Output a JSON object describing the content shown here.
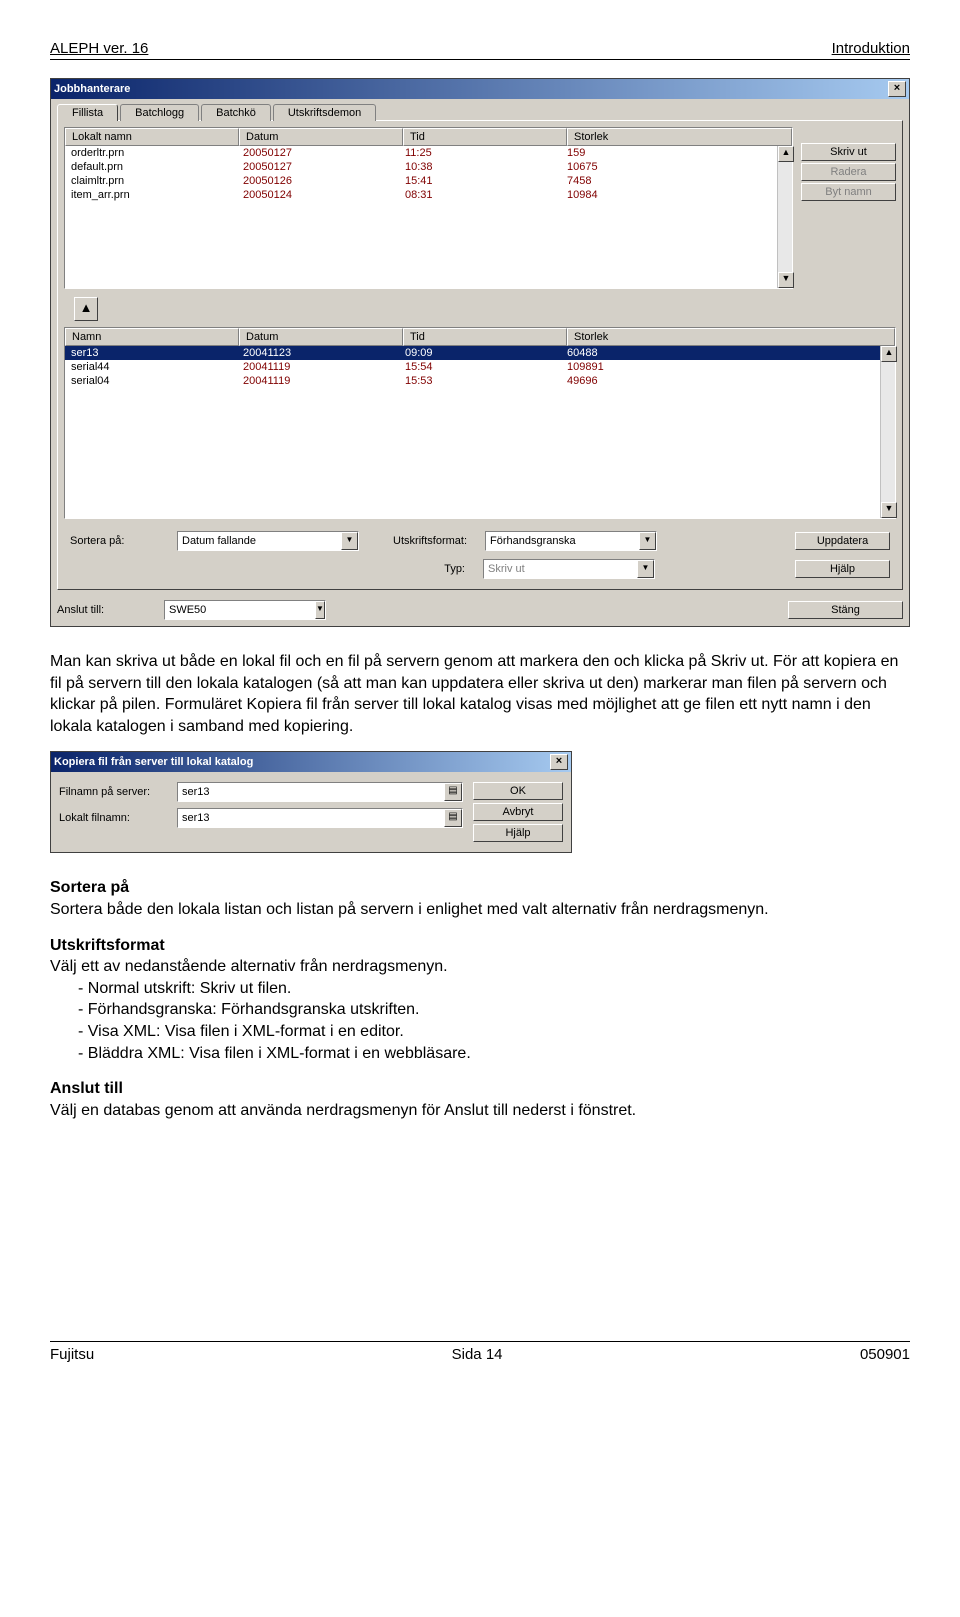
{
  "header": {
    "left": "ALEPH ver. 16",
    "right": "Introduktion"
  },
  "window1": {
    "title": "Jobbhanterare",
    "tabs": [
      "Fillista",
      "Batchlogg",
      "Batchkö",
      "Utskriftsdemon"
    ],
    "cols_top": [
      "Lokalt namn",
      "Datum",
      "Tid",
      "Storlek"
    ],
    "rows_top": [
      {
        "name": "orderltr.prn",
        "date": "20050127",
        "time": "11:25",
        "size": "159"
      },
      {
        "name": "default.prn",
        "date": "20050127",
        "time": "10:38",
        "size": "10675"
      },
      {
        "name": "claimltr.prn",
        "date": "20050126",
        "time": "15:41",
        "size": "7458"
      },
      {
        "name": "item_arr.prn",
        "date": "20050124",
        "time": "08:31",
        "size": "10984"
      }
    ],
    "rbtns": {
      "print": "Skriv ut",
      "delete": "Radera",
      "rename": "Byt namn"
    },
    "arrow": "▲",
    "cols_bot": [
      "Namn",
      "Datum",
      "Tid",
      "Storlek"
    ],
    "rows_bot": [
      {
        "name": "ser13",
        "date": "20041123",
        "time": "09:09",
        "size": "60488"
      },
      {
        "name": "serial44",
        "date": "20041119",
        "time": "15:54",
        "size": "109891"
      },
      {
        "name": "serial04",
        "date": "20041119",
        "time": "15:53",
        "size": "49696"
      }
    ],
    "sort_label": "Sortera på:",
    "sort_value": "Datum fallande",
    "format_label": "Utskriftsformat:",
    "format_value": "Förhandsgranska",
    "type_label": "Typ:",
    "type_value": "Skriv ut",
    "update_btn": "Uppdatera",
    "help_btn": "Hjälp",
    "connect_label": "Anslut till:",
    "connect_value": "SWE50",
    "close_btn": "Stäng"
  },
  "text1": "Man kan skriva ut både en lokal fil och en fil på servern genom att markera den och klicka på Skriv ut. För att kopiera en fil på servern till den lokala katalogen (så att man kan uppdatera eller skriva ut den) markerar man filen på servern och klickar på pilen. Formuläret Kopiera fil från server till lokal katalog visas med möjlighet att ge filen ett nytt namn i den lokala katalogen i samband med kopiering.",
  "dialog2": {
    "title": "Kopiera fil från server till lokal katalog",
    "fn_server_label": "Filnamn på server:",
    "fn_server_value": "ser13",
    "fn_local_label": "Lokalt filnamn:",
    "fn_local_value": "ser13",
    "ok": "OK",
    "cancel": "Avbryt",
    "help": "Hjälp"
  },
  "sections": {
    "sort_h": "Sortera på",
    "sort_b": "Sortera både den lokala listan och listan på servern i enlighet med valt alternativ från nerdragsmenyn.",
    "fmt_h": "Utskriftsformat",
    "fmt_b": "Välj ett av nedanstående alternativ från nerdragsmenyn.",
    "b1": "-   Normal utskrift: Skriv ut filen.",
    "b2": "-   Förhandsgranska: Förhandsgranska utskriften.",
    "b3": "-   Visa XML: Visa filen i XML-format i en editor.",
    "b4": "-   Bläddra XML: Visa filen i XML-format i en webbläsare.",
    "conn_h": "Anslut till",
    "conn_b": "Välj en databas genom att använda nerdragsmenyn för Anslut till nederst i fönstret."
  },
  "footer": {
    "left": "Fujitsu",
    "mid": "Sida 14",
    "right": "050901"
  }
}
